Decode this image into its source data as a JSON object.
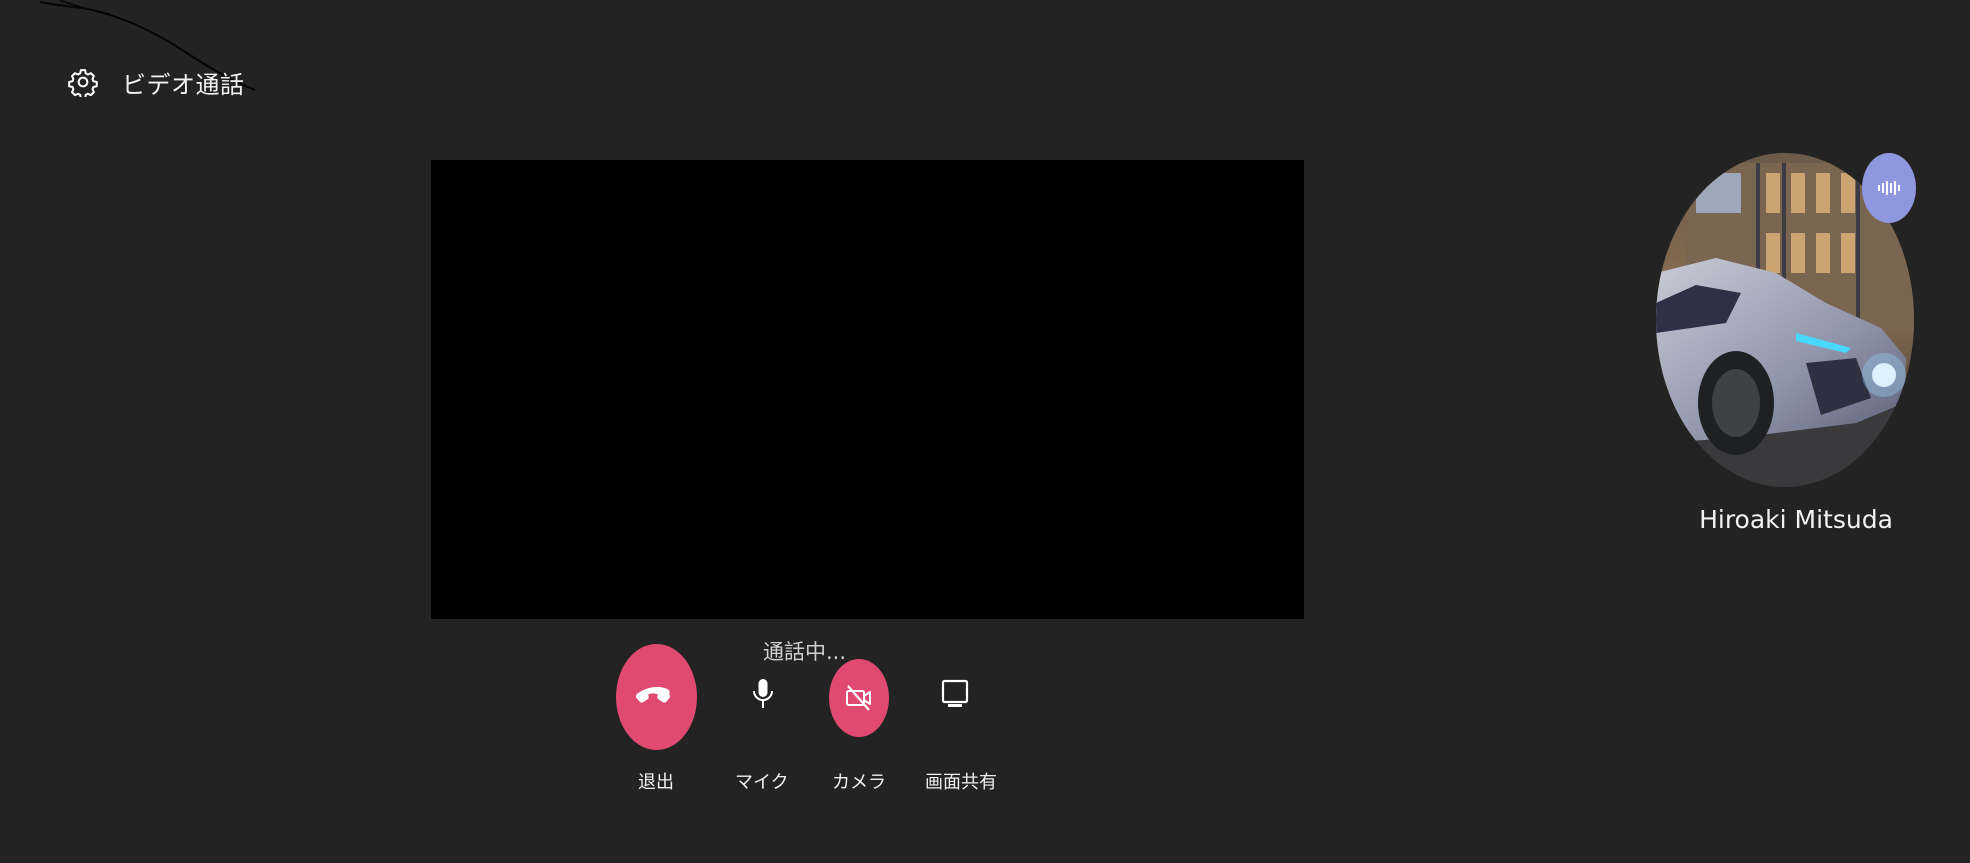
{
  "header": {
    "settings_icon": "gear-icon",
    "title": "ビデオ通話"
  },
  "call": {
    "status": "通話中..."
  },
  "controls": {
    "leave": {
      "label": "退出",
      "icon": "phone-hangup-icon"
    },
    "mic": {
      "label": "マイク",
      "icon": "microphone-icon"
    },
    "camera": {
      "label": "カメラ",
      "icon": "camera-off-icon"
    },
    "screen_share": {
      "label": "画面共有",
      "icon": "monitor-icon"
    }
  },
  "participant": {
    "name": "Hiroaki Mitsuda",
    "speaking_icon": "audio-wave-icon"
  },
  "colors": {
    "background": "#232323",
    "video": "#000000",
    "danger": "#e04a70",
    "speaking": "#8f97e0"
  }
}
